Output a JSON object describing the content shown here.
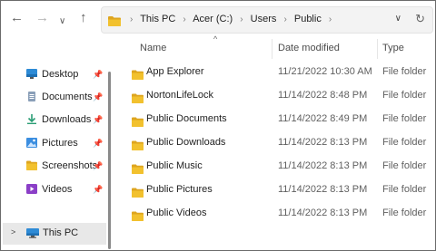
{
  "toolbar": {
    "back": "←",
    "forward": "→",
    "recent": "∨",
    "up": "↑"
  },
  "address": {
    "crumbs": [
      "This PC",
      "Acer (C:)",
      "Users",
      "Public"
    ],
    "separator": "›",
    "dropdown": "∨",
    "refresh": "↻"
  },
  "sidebar": {
    "items": [
      {
        "label": "Desktop",
        "icon": "desktop-icon",
        "pin": "📌"
      },
      {
        "label": "Documents",
        "icon": "documents-icon",
        "pin": "📌"
      },
      {
        "label": "Downloads",
        "icon": "downloads-icon",
        "pin": "📌"
      },
      {
        "label": "Pictures",
        "icon": "pictures-icon",
        "pin": "📌"
      },
      {
        "label": "Screenshots",
        "icon": "folder-icon",
        "pin": "📌"
      },
      {
        "label": "Videos",
        "icon": "videos-icon",
        "pin": "📌"
      }
    ],
    "this_pc": {
      "label": "This PC",
      "chevron": ">"
    }
  },
  "columns": {
    "name": "Name",
    "date": "Date modified",
    "type": "Type",
    "sort": "^"
  },
  "files": [
    {
      "name": "App Explorer",
      "date": "11/21/2022 10:30 AM",
      "type": "File folder"
    },
    {
      "name": "NortonLifeLock",
      "date": "11/14/2022 8:48 PM",
      "type": "File folder"
    },
    {
      "name": "Public Documents",
      "date": "11/14/2022 8:49 PM",
      "type": "File folder"
    },
    {
      "name": "Public Downloads",
      "date": "11/14/2022 8:13 PM",
      "type": "File folder"
    },
    {
      "name": "Public Music",
      "date": "11/14/2022 8:13 PM",
      "type": "File folder"
    },
    {
      "name": "Public Pictures",
      "date": "11/14/2022 8:13 PM",
      "type": "File folder"
    },
    {
      "name": "Public Videos",
      "date": "11/14/2022 8:13 PM",
      "type": "File folder"
    }
  ],
  "colors": {
    "folder": "#f2c12e",
    "folder_dark": "#dea51f",
    "selection": "#e8e8e8",
    "accent": "#0078d4"
  }
}
